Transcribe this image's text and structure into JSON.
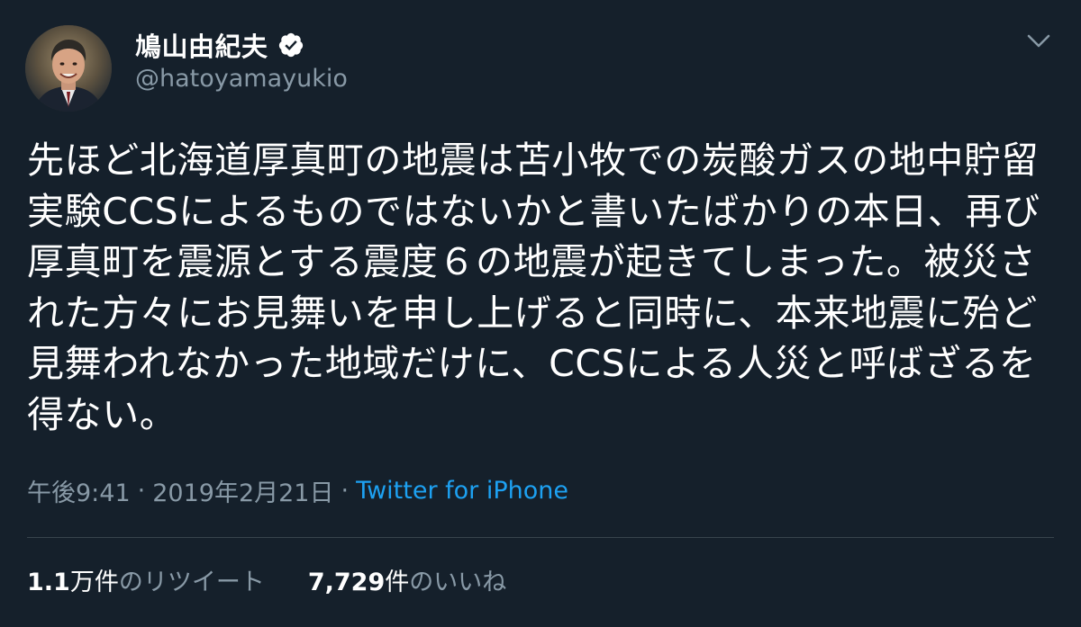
{
  "user": {
    "display_name": "鳩山由紀夫",
    "handle": "@hatoyamayukio",
    "verified": true
  },
  "tweet": {
    "text": "先ほど北海道厚真町の地震は苫小牧での炭酸ガスの地中貯留実験CCSによるものではないかと書いたばかりの本日、再び厚真町を震源とする震度６の地震が起きてしまった。被災された方々にお見舞いを申し上げると同時に、本来地震に殆ど見舞われなかった地域だけに、CCSによる人災と呼ばざるを得ない。",
    "time": "午後9:41",
    "date": "2019年2月21日",
    "separator": "·",
    "source": "Twitter for iPhone"
  },
  "stats": {
    "retweets": {
      "num": "1.1",
      "unit": "万件",
      "label": "のリツイート"
    },
    "likes": {
      "num": "7,729",
      "unit": "件",
      "label": "のいいね"
    }
  },
  "colors": {
    "background": "#15202b",
    "secondary_text": "#8899a6",
    "accent": "#1da1f2",
    "divider": "#38444d"
  },
  "icons": {
    "verified": "verified-badge-icon",
    "more": "chevron-down-icon"
  }
}
